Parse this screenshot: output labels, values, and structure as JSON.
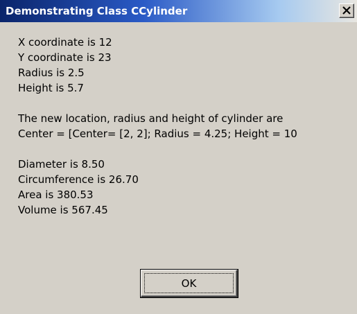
{
  "window": {
    "title": "Demonstrating Class CCylinder"
  },
  "titlebar_colors": {
    "start": "#0a246a",
    "end": "#a6caf0"
  },
  "message": {
    "lines": [
      "X coordinate is 12",
      "Y coordinate is 23",
      "Radius is 2.5",
      "Height is 5.7",
      "The new location, radius and height of cylinder are",
      "Center = [Center= [2, 2]; Radius = 4.25; Height = 10",
      "Diameter is 8.50",
      "Circumference is 26.70",
      "Area is 380.53",
      "Volume is 567.45"
    ]
  },
  "buttons": {
    "ok_label": "OK",
    "close_icon": "close-icon"
  }
}
